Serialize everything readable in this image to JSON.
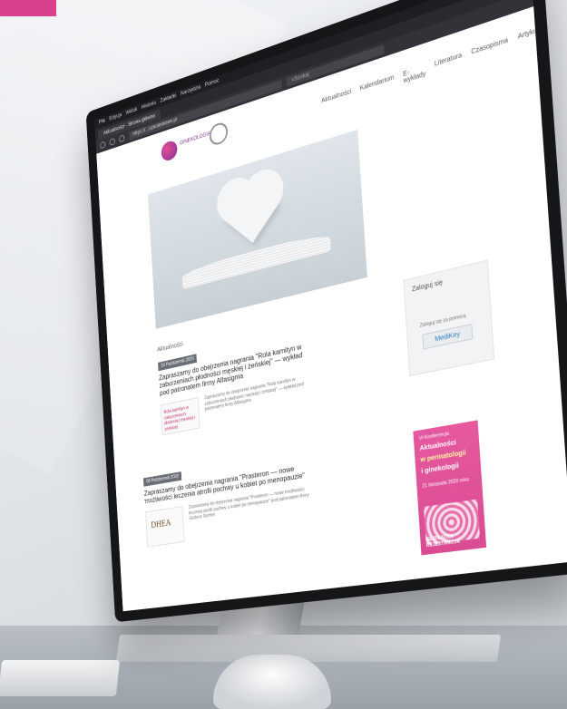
{
  "browser": {
    "menu": [
      "Plik",
      "Edycja",
      "Widok",
      "Historia",
      "Zakładki",
      "Narzędzia",
      "Pomoc"
    ],
    "tab_title": "Aktualności - Strona główna",
    "address": "https://...szkoleniowe.pl",
    "search_placeholder": "Szukaj",
    "controls": [
      "–",
      "□",
      "✕"
    ]
  },
  "site": {
    "logo_text": "GINEKOLOGIA",
    "nav": [
      "Aktualności",
      "Kalendarium",
      "E-wykłady",
      "Literatura",
      "Czasopisma",
      "Artykuły"
    ]
  },
  "main": {
    "section_title": "Aktualności",
    "posts": [
      {
        "date": "16 Październik 2020",
        "title": "Zapraszamy do obejrzenia nagrania \"Rola karnityn w zaburzeniach płodności męskiej i żeńskiej\" — wykład pod patronatem firmy Alfasigma",
        "excerpt": "Zapraszamy do obejrzenia nagrania \"Rola karnityn w zaburzeniach płodności męskiej i żeńskiej\" — wykład pod patronatem firmy Alfasigma",
        "thumb_text": "Rola karnityn w zaburzeniach płodności męskiej i żeńskiej"
      },
      {
        "date": "08 Październik 2020",
        "title": "Zapraszamy do obejrzenia nagrania \"Prasteron — nowe możliwości leczenia atrofii pochwy u kobiet po menopauzie\"",
        "excerpt": "Zapraszamy do obejrzenia nagrania \"Prasteron — nowe możliwości leczenia atrofii pochwy u kobiet po menopauzie\" pod patronatem firmy Gedeon Richter",
        "thumb_text": "DHEA"
      }
    ]
  },
  "sidebar": {
    "login_title": "Zaloguj się",
    "login_hint": "Zaloguj się za pomocą",
    "login_button": "MediKey",
    "ad": {
      "small_top": "VI Konferencja",
      "line1": "Aktualności",
      "line2": "w perinatologii",
      "line3": "i ginekologii",
      "date": "21 listopada 2020 roku",
      "cta": "BEZPŁATNA REJESTRACJA"
    }
  },
  "colors": {
    "brand_pink": "#d9418f",
    "bezel": "#141618",
    "browser_chrome": "#2a2b2f"
  }
}
